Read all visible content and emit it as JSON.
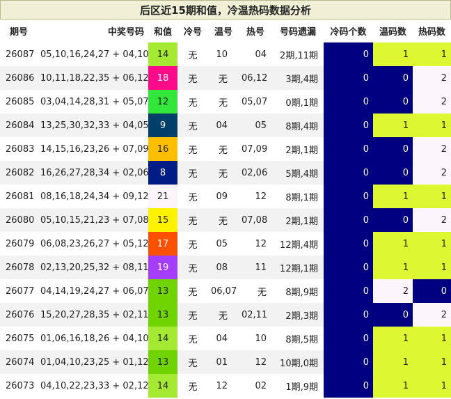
{
  "title": "后区近15期和值，冷温热码数据分析",
  "headers": [
    "期号",
    "中奖号码",
    "和值",
    "冷号",
    "温号",
    "热号",
    "号码遗漏",
    "冷码个数",
    "温码数",
    "热码数"
  ],
  "colors": {
    "sum_colors": {
      "8": "#001d85",
      "9": "#003f6a",
      "12": "#33e63a",
      "13": "#6fd400",
      "14": "#a4ea33",
      "15": "#fff200",
      "16": "#ffbf00",
      "17": "#ff5000",
      "18": "#ff0b89",
      "19": "#a53dff",
      "21": "#fdf5fa"
    },
    "lime": "#ddf732",
    "navy": "#000080",
    "pale": "#fcf5fb"
  },
  "rows": [
    {
      "issue": "26087",
      "numbers": "05,10,16,24,27 + 04,10",
      "sum": "14",
      "cold": "无",
      "warm": "10",
      "hot": "04",
      "miss": "2期,11期",
      "cold_count": "0",
      "warm_count": "1",
      "hot_count": "1"
    },
    {
      "issue": "26086",
      "numbers": "10,11,18,22,35 + 06,12",
      "sum": "18",
      "cold": "无",
      "warm": "无",
      "hot": "06,12",
      "miss": "3期,4期",
      "cold_count": "0",
      "warm_count": "0",
      "hot_count": "2"
    },
    {
      "issue": "26085",
      "numbers": "03,04,14,28,31 + 05,07",
      "sum": "12",
      "cold": "无",
      "warm": "无",
      "hot": "05,07",
      "miss": "0期,1期",
      "cold_count": "0",
      "warm_count": "0",
      "hot_count": "2"
    },
    {
      "issue": "26084",
      "numbers": "13,25,30,32,33 + 04,05",
      "sum": "9",
      "cold": "无",
      "warm": "04",
      "hot": "05",
      "miss": "8期,4期",
      "cold_count": "0",
      "warm_count": "1",
      "hot_count": "1"
    },
    {
      "issue": "26083",
      "numbers": "14,15,16,23,26 + 07,09",
      "sum": "16",
      "cold": "无",
      "warm": "无",
      "hot": "07,09",
      "miss": "2期,1期",
      "cold_count": "0",
      "warm_count": "0",
      "hot_count": "2"
    },
    {
      "issue": "26082",
      "numbers": "16,26,27,28,34 + 02,06",
      "sum": "8",
      "cold": "无",
      "warm": "无",
      "hot": "02,06",
      "miss": "5期,4期",
      "cold_count": "0",
      "warm_count": "0",
      "hot_count": "2"
    },
    {
      "issue": "26081",
      "numbers": "08,16,18,24,34 + 09,12",
      "sum": "21",
      "cold": "无",
      "warm": "09",
      "hot": "12",
      "miss": "8期,1期",
      "cold_count": "0",
      "warm_count": "1",
      "hot_count": "1"
    },
    {
      "issue": "26080",
      "numbers": "05,10,15,21,23 + 07,08",
      "sum": "15",
      "cold": "无",
      "warm": "无",
      "hot": "07,08",
      "miss": "2期,1期",
      "cold_count": "0",
      "warm_count": "0",
      "hot_count": "2"
    },
    {
      "issue": "26079",
      "numbers": "06,08,23,26,27 + 05,12",
      "sum": "17",
      "cold": "无",
      "warm": "05",
      "hot": "12",
      "miss": "12期,4期",
      "cold_count": "0",
      "warm_count": "1",
      "hot_count": "1"
    },
    {
      "issue": "26078",
      "numbers": "02,13,20,25,32 + 08,11",
      "sum": "19",
      "cold": "无",
      "warm": "08",
      "hot": "11",
      "miss": "12期,1期",
      "cold_count": "0",
      "warm_count": "1",
      "hot_count": "1"
    },
    {
      "issue": "26077",
      "numbers": "04,14,19,24,27 + 06,07",
      "sum": "13",
      "cold": "无",
      "warm": "06,07",
      "hot": "无",
      "miss": "8期,9期",
      "cold_count": "0",
      "warm_count": "2",
      "hot_count": "0"
    },
    {
      "issue": "26076",
      "numbers": "15,20,27,28,35 + 02,11",
      "sum": "13",
      "cold": "无",
      "warm": "无",
      "hot": "02,11",
      "miss": "2期,3期",
      "cold_count": "0",
      "warm_count": "0",
      "hot_count": "2"
    },
    {
      "issue": "26075",
      "numbers": "01,06,16,18,26 + 04,10",
      "sum": "14",
      "cold": "无",
      "warm": "04",
      "hot": "10",
      "miss": "8期,5期",
      "cold_count": "0",
      "warm_count": "1",
      "hot_count": "1"
    },
    {
      "issue": "26074",
      "numbers": "01,04,10,23,25 + 01,12",
      "sum": "13",
      "cold": "无",
      "warm": "01",
      "hot": "12",
      "miss": "10期,0期",
      "cold_count": "0",
      "warm_count": "1",
      "hot_count": "1"
    },
    {
      "issue": "26073",
      "numbers": "04,10,22,23,33 + 02,12",
      "sum": "14",
      "cold": "无",
      "warm": "12",
      "hot": "02",
      "miss": "1期,9期",
      "cold_count": "0",
      "warm_count": "1",
      "hot_count": "1"
    }
  ]
}
